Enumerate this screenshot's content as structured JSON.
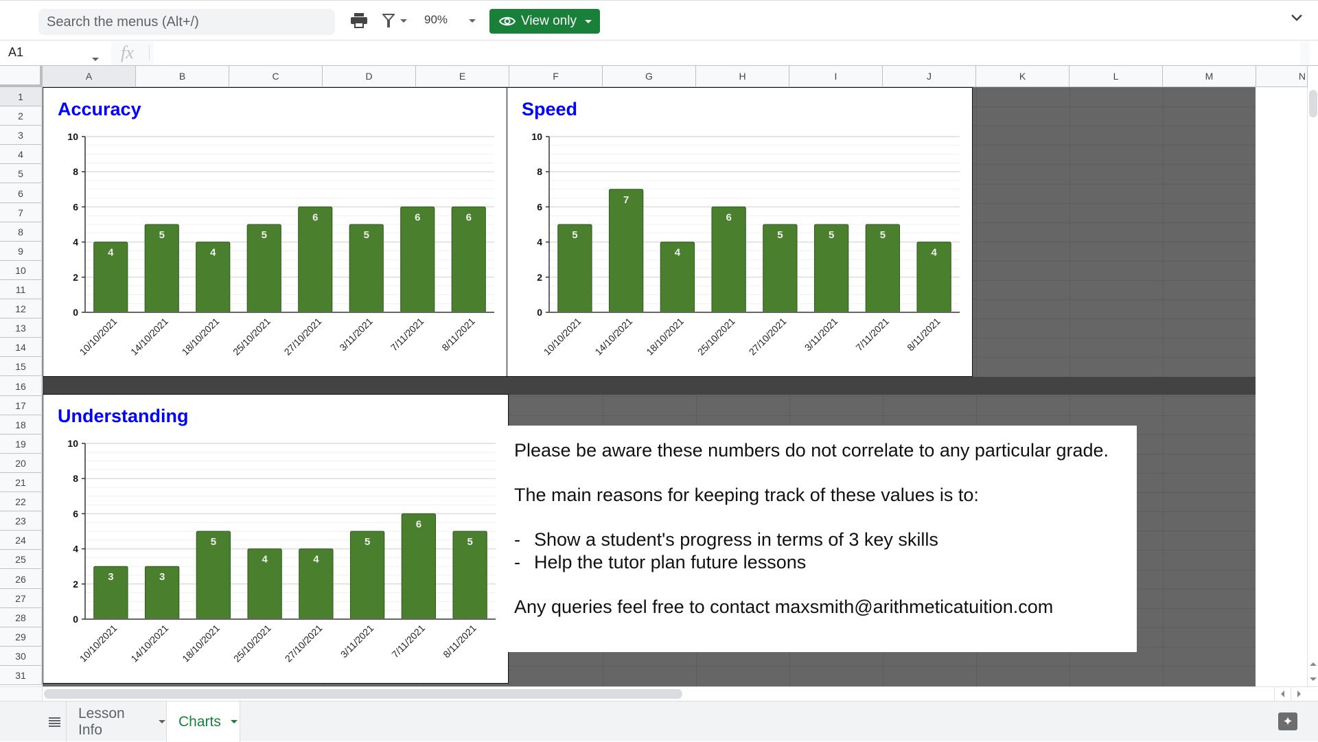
{
  "toolbar": {
    "search_placeholder": "Search the menus (Alt+/)",
    "print_icon": "printer-icon",
    "filter_icon": "filter-icon",
    "zoom": "90%",
    "view_mode": "View only",
    "collapse_icon": "chevron-down-icon"
  },
  "formula_bar": {
    "cell_ref": "A1",
    "fx_label": "fx",
    "value": ""
  },
  "columns": [
    "A",
    "B",
    "C",
    "D",
    "E",
    "F",
    "G",
    "H",
    "I",
    "J",
    "K",
    "L",
    "M",
    "N"
  ],
  "rows": [
    "1",
    "2",
    "3",
    "4",
    "5",
    "6",
    "7",
    "8",
    "9",
    "10",
    "11",
    "12",
    "13",
    "14",
    "15",
    "16",
    "17",
    "18",
    "19",
    "20",
    "21",
    "22",
    "23",
    "24",
    "25",
    "26",
    "27",
    "28",
    "29",
    "30",
    "31"
  ],
  "sheet_tabs": [
    {
      "label": "Lesson Info",
      "active": false
    },
    {
      "label": "Charts",
      "active": true
    }
  ],
  "colors": {
    "bar": "#4a7f2e",
    "chart_title": "#0000ff",
    "accent": "#188038",
    "shaded_cells": "#666666",
    "band": "#434343"
  },
  "note": {
    "line1": "Please be aware these numbers do not correlate to any particular grade.",
    "line2": "The main reasons for keeping track of these values is to:",
    "bullet_dash": "-",
    "bullets": [
      "Show a student's progress in terms of 3 key skills",
      "Help the tutor plan future lessons"
    ],
    "line3": "Any queries feel free to contact maxsmith@arithmeticatuition.com"
  },
  "chart_data": [
    {
      "type": "bar",
      "title": "Accuracy",
      "categories": [
        "10/10/2021",
        "14/10/2021",
        "18/10/2021",
        "25/10/2021",
        "27/10/2021",
        "3/11/2021",
        "7/11/2021",
        "8/11/2021"
      ],
      "values": [
        4,
        5,
        4,
        5,
        6,
        5,
        6,
        6
      ],
      "xlabel": "",
      "ylabel": "",
      "ylim": [
        0,
        10
      ],
      "yticks": [
        0,
        2,
        4,
        6,
        8,
        10
      ],
      "minor_gridlines": true,
      "data_labels": true,
      "legend": "none"
    },
    {
      "type": "bar",
      "title": "Speed",
      "categories": [
        "10/10/2021",
        "14/10/2021",
        "18/10/2021",
        "25/10/2021",
        "27/10/2021",
        "3/11/2021",
        "7/11/2021",
        "8/11/2021"
      ],
      "values": [
        5,
        7,
        4,
        6,
        5,
        5,
        5,
        4
      ],
      "xlabel": "",
      "ylabel": "",
      "ylim": [
        0,
        10
      ],
      "yticks": [
        0,
        2,
        4,
        6,
        8,
        10
      ],
      "minor_gridlines": true,
      "data_labels": true,
      "legend": "none"
    },
    {
      "type": "bar",
      "title": "Understanding",
      "categories": [
        "10/10/2021",
        "14/10/2021",
        "18/10/2021",
        "25/10/2021",
        "27/10/2021",
        "3/11/2021",
        "7/11/2021",
        "8/11/2021"
      ],
      "values": [
        3,
        3,
        5,
        4,
        4,
        5,
        6,
        5
      ],
      "xlabel": "",
      "ylabel": "",
      "ylim": [
        0,
        10
      ],
      "yticks": [
        0,
        2,
        4,
        6,
        8,
        10
      ],
      "minor_gridlines": true,
      "data_labels": true,
      "legend": "none"
    }
  ]
}
